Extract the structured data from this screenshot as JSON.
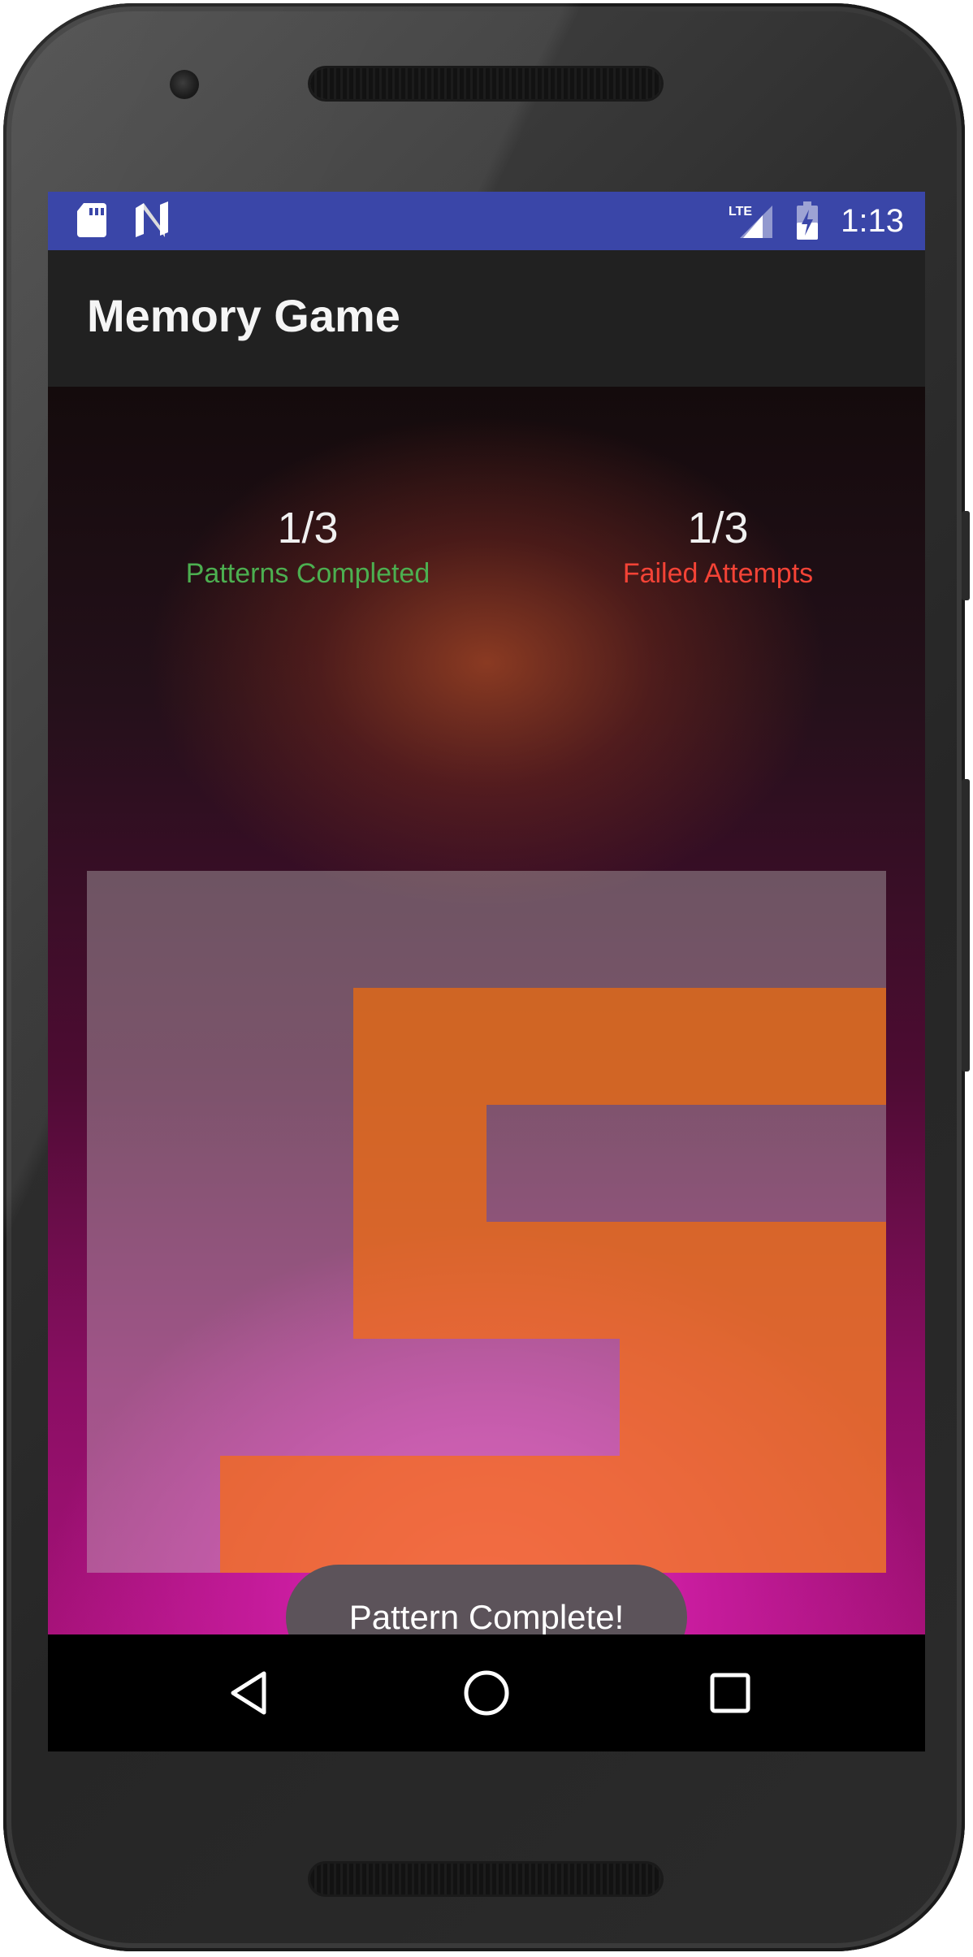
{
  "status_bar": {
    "time": "1:13",
    "network": "LTE",
    "left_icons": [
      "sd-card-icon",
      "n-logo-icon"
    ],
    "right_icons": [
      "lte-signal-icon",
      "battery-charging-icon"
    ]
  },
  "app_bar": {
    "title": "Memory Game"
  },
  "stats": {
    "patterns_completed_value": "1/3",
    "patterns_completed_label": "Patterns Completed",
    "failed_attempts_value": "1/3",
    "failed_attempts_label": "Failed Attempts"
  },
  "grid": {
    "columns": 6,
    "rows": 6,
    "lit_cells": [
      [
        1,
        2
      ],
      [
        1,
        3
      ],
      [
        1,
        4
      ],
      [
        1,
        5
      ],
      [
        2,
        2
      ],
      [
        3,
        2
      ],
      [
        3,
        3
      ],
      [
        3,
        4
      ],
      [
        3,
        5
      ],
      [
        4,
        4
      ],
      [
        4,
        5
      ],
      [
        5,
        1
      ],
      [
        5,
        2
      ],
      [
        5,
        3
      ],
      [
        5,
        4
      ],
      [
        5,
        5
      ]
    ]
  },
  "toast": {
    "message": "Pattern Complete!"
  },
  "nav_bar": {
    "back": "back-icon",
    "home": "home-icon",
    "recents": "recents-icon"
  },
  "colors": {
    "status_bar": "#3a46a8",
    "app_bar": "#212121",
    "patterns_label": "#4caf50",
    "failed_label": "#f44336",
    "lit_cell": "#ff6e00",
    "toast_bg": "#5c535a"
  }
}
